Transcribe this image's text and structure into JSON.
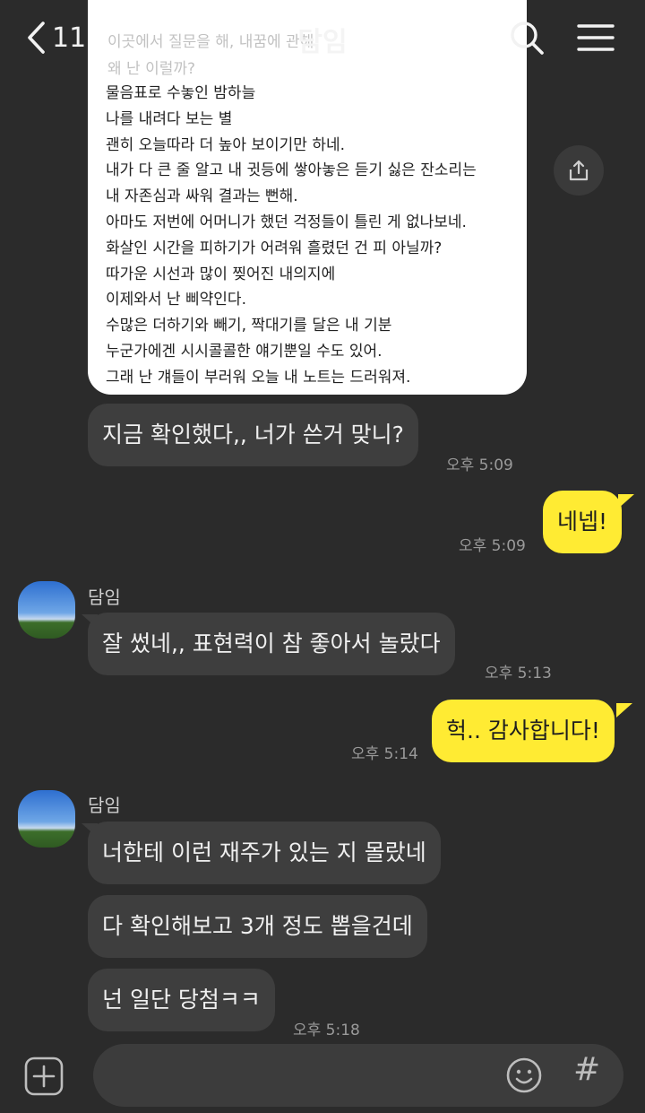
{
  "header": {
    "back_count": "11",
    "title": "담임"
  },
  "file_card": {
    "ghost_lines": [
      "이곳에서 질문을 해, 내꿈에 관해",
      "왜 난 이럴까?"
    ],
    "lines": [
      "물음표로 수놓인 밤하늘",
      "나를 내려다 보는 별",
      "괜히 오늘따라 더 높아 보이기만 하네.",
      "내가 다 큰 줄 알고 내 귓등에 쌓아놓은 듣기 싫은 잔소리는",
      "내 자존심과 싸워 결과는 뻔해.",
      "아마도 저번에 어머니가 했던 걱정들이 틀린 게 없나보네.",
      "화살인 시간을 피하기가 어려워 흘렸던 건 피 아닐까?",
      "따가운 시선과 많이 찢어진 내의지에",
      "이제와서 난 삐약인다.",
      "수많은 더하기와 빼기, 짝대기를 달은 내 기분",
      "누군가에겐 시시콜콜한 얘기뿐일 수도 있어.",
      "그래 난 걔들이 부러워 오늘 내 노트는 드러워져."
    ]
  },
  "messages": [
    {
      "text": "지금 확인했다,, 너가 쓴거 맞니?",
      "time": "오후 5:09"
    },
    {
      "text": "네넵!",
      "time": "오후 5:09"
    },
    {
      "sender": "담임",
      "text": "잘 썼네,, 표현력이 참 좋아서 놀랐다",
      "time": "오후 5:13"
    },
    {
      "text": "헉.. 감사합니다!",
      "time": "오후 5:14"
    },
    {
      "sender": "담임",
      "text": "너한테 이런 재주가 있는 지 몰랐네"
    },
    {
      "text": "다 확인해보고 3개 정도 뽑을건데"
    },
    {
      "text": "넌 일단 당첨ㅋㅋ",
      "time": "오후 5:18"
    }
  ],
  "composer": {
    "value": "",
    "hash_label": "#"
  },
  "colors": {
    "background": "#2b2b2b",
    "incoming_bubble": "#3e3e3e",
    "outgoing_bubble": "#ffeb33"
  }
}
